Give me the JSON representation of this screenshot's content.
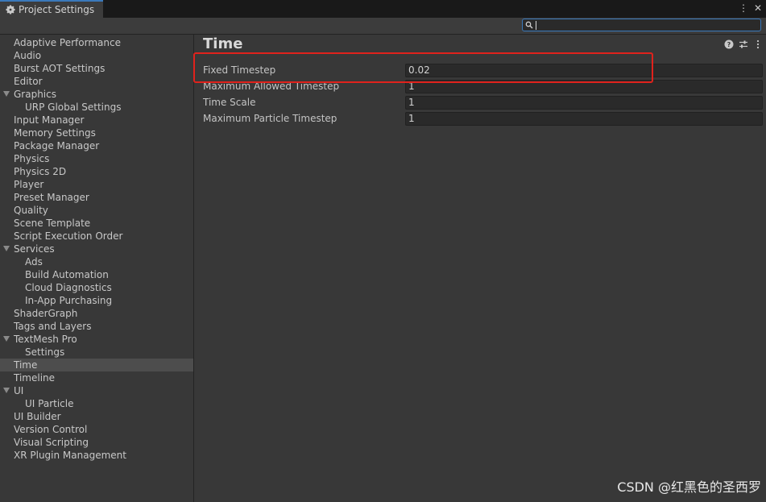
{
  "window": {
    "tab_title": "Project Settings",
    "controls": [
      "more-icon",
      "close-icon"
    ]
  },
  "search": {
    "value": "",
    "placeholder": ""
  },
  "sidebar": {
    "items": [
      {
        "label": "Adaptive Performance",
        "indent": 0,
        "expandable": false
      },
      {
        "label": "Audio",
        "indent": 0,
        "expandable": false
      },
      {
        "label": "Burst AOT Settings",
        "indent": 0,
        "expandable": false
      },
      {
        "label": "Editor",
        "indent": 0,
        "expandable": false
      },
      {
        "label": "Graphics",
        "indent": 0,
        "expandable": true
      },
      {
        "label": "URP Global Settings",
        "indent": 1,
        "expandable": false
      },
      {
        "label": "Input Manager",
        "indent": 0,
        "expandable": false
      },
      {
        "label": "Memory Settings",
        "indent": 0,
        "expandable": false
      },
      {
        "label": "Package Manager",
        "indent": 0,
        "expandable": false
      },
      {
        "label": "Physics",
        "indent": 0,
        "expandable": false
      },
      {
        "label": "Physics 2D",
        "indent": 0,
        "expandable": false
      },
      {
        "label": "Player",
        "indent": 0,
        "expandable": false
      },
      {
        "label": "Preset Manager",
        "indent": 0,
        "expandable": false
      },
      {
        "label": "Quality",
        "indent": 0,
        "expandable": false
      },
      {
        "label": "Scene Template",
        "indent": 0,
        "expandable": false
      },
      {
        "label": "Script Execution Order",
        "indent": 0,
        "expandable": false
      },
      {
        "label": "Services",
        "indent": 0,
        "expandable": true
      },
      {
        "label": "Ads",
        "indent": 1,
        "expandable": false
      },
      {
        "label": "Build Automation",
        "indent": 1,
        "expandable": false
      },
      {
        "label": "Cloud Diagnostics",
        "indent": 1,
        "expandable": false
      },
      {
        "label": "In-App Purchasing",
        "indent": 1,
        "expandable": false
      },
      {
        "label": "ShaderGraph",
        "indent": 0,
        "expandable": false
      },
      {
        "label": "Tags and Layers",
        "indent": 0,
        "expandable": false
      },
      {
        "label": "TextMesh Pro",
        "indent": 0,
        "expandable": true
      },
      {
        "label": "Settings",
        "indent": 1,
        "expandable": false
      },
      {
        "label": "Time",
        "indent": 0,
        "expandable": false,
        "selected": true
      },
      {
        "label": "Timeline",
        "indent": 0,
        "expandable": false
      },
      {
        "label": "UI",
        "indent": 0,
        "expandable": true
      },
      {
        "label": "UI Particle",
        "indent": 1,
        "expandable": false
      },
      {
        "label": "UI Builder",
        "indent": 0,
        "expandable": false
      },
      {
        "label": "Version Control",
        "indent": 0,
        "expandable": false
      },
      {
        "label": "Visual Scripting",
        "indent": 0,
        "expandable": false
      },
      {
        "label": "XR Plugin Management",
        "indent": 0,
        "expandable": false
      }
    ]
  },
  "main": {
    "title": "Time",
    "header_icons": [
      "help-icon",
      "preset-icon",
      "more-icon"
    ],
    "properties": [
      {
        "label": "Fixed Timestep",
        "value": "0.02"
      },
      {
        "label": "Maximum Allowed Timestep",
        "value": "1"
      },
      {
        "label": "Time Scale",
        "value": "1"
      },
      {
        "label": "Maximum Particle Timestep",
        "value": "1"
      }
    ]
  },
  "watermark": "CSDN @红黑色的圣西罗",
  "colors": {
    "accent": "#3a79bb",
    "highlight_box": "#e0221c",
    "background": "#383838",
    "selected_row": "#4d4d4d"
  }
}
